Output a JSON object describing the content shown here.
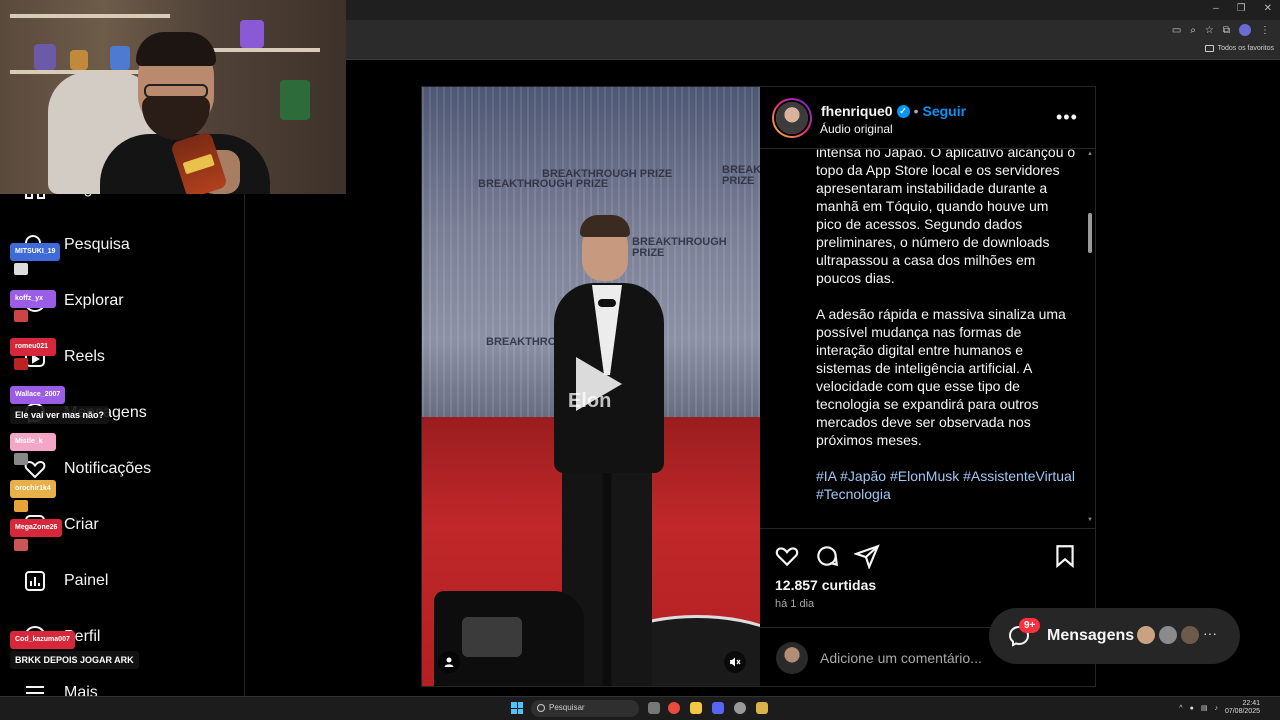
{
  "browser": {
    "bookmarks_folder": "Todos os favoritos"
  },
  "sidebar": {
    "items": [
      {
        "label": "Página inicial",
        "icon": "home-icon"
      },
      {
        "label": "Pesquisa",
        "icon": "search-icon"
      },
      {
        "label": "Explorar",
        "icon": "compass-icon"
      },
      {
        "label": "Reels",
        "icon": "reels-icon"
      },
      {
        "label": "Mensagens",
        "icon": "messenger-icon"
      },
      {
        "label": "Notificações",
        "icon": "heart-icon"
      },
      {
        "label": "Criar",
        "icon": "plus-square-icon"
      },
      {
        "label": "Painel",
        "icon": "dashboard-icon"
      },
      {
        "label": "Perfil",
        "icon": "profile-icon"
      },
      {
        "label": "Mais",
        "icon": "menu-icon"
      }
    ]
  },
  "chat": {
    "messages": [
      {
        "user": "MITSUKI_19",
        "color": "#3f6bd6"
      },
      {
        "user": "koffz_yx",
        "color": "#9b5de5"
      },
      {
        "user": "romeu021",
        "color": "#d6283a"
      },
      {
        "user": "Wallace_2007",
        "color": "#9b5de5",
        "text": "Ele vai ver mas não?"
      },
      {
        "user": "Mistle_k",
        "color": "#f4a6c6"
      },
      {
        "user": "orochir1k4",
        "color": "#e8b04a"
      },
      {
        "user": "MegaZone26",
        "color": "#d6283a"
      },
      {
        "user": "Cod_kazuma007",
        "color": "#d6283a",
        "text": "BRKK DEPOIS JOGAR ARK"
      }
    ]
  },
  "post": {
    "username": "fhenrique0",
    "follow_separator": "•",
    "follow_label": "Seguir",
    "audio_label": "Áudio original",
    "video_overlay_text": "Elon",
    "backdrop_text": "BREAKTHROUGH PRIZE",
    "caption_paragraphs": [
      "intensa no Japão. O aplicativo alcançou o topo da App Store local e os servidores apresentaram instabilidade durante a manhã em Tóquio, quando houve um pico de acessos. Segundo dados preliminares, o número de downloads ultrapassou a casa dos milhões em poucos dias.",
      "A adesão rápida e massiva sinaliza uma possível mudança nas formas de interação digital entre humanos e sistemas de inteligência artificial. A velocidade com que esse tipo de tecnologia se expandirá para outros mercados deve ser observada nos próximos meses."
    ],
    "hashtags": [
      "#IA",
      "#Japão",
      "#ElonMusk",
      "#AssistenteVirtual",
      "#Tecnologia"
    ],
    "likes": "12.857 curtidas",
    "time": "há 1 dia",
    "comment_placeholder": "Adicione um comentário..."
  },
  "messages_pill": {
    "label": "Mensagens",
    "badge": "9+"
  },
  "taskbar": {
    "search_label": "Pesquisar",
    "time": "22:41",
    "date": "07/08/2025"
  },
  "colors": {
    "accent": "#0095f6",
    "background": "#000000",
    "border": "#262626"
  }
}
